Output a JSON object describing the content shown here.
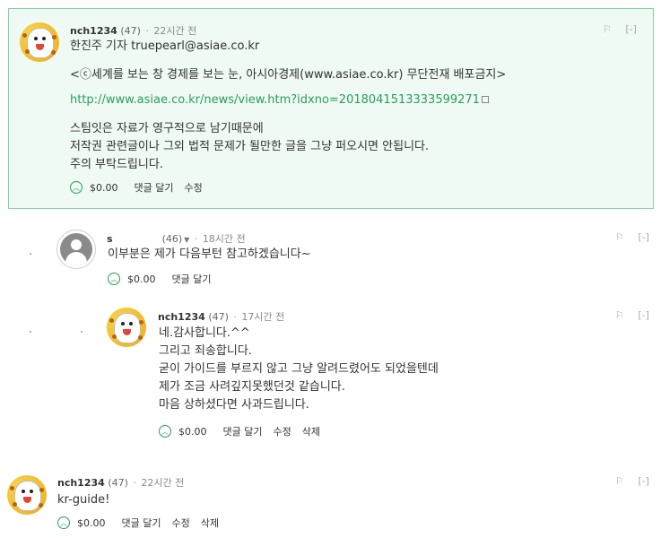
{
  "comments": [
    {
      "author": "nch1234",
      "reputation": "(47)",
      "separator": "·",
      "time": "22시간 전",
      "flag": "⚐",
      "collapse": "[-]",
      "lines": [
        "한진주 기자 truepearl@asiae.co.kr",
        "<ⓒ세계를 보는 창 경제를 보는 눈, 아시아경제(www.asiae.co.kr) 무단전재 배포금지>",
        "스팀잇은 자료가 영구적으로 남기때문에",
        "저작권 관련글이나 그외 법적 문제가 될만한 글을 그냥 퍼오시면 안됩니다.",
        "주의 부탁드립니다."
      ],
      "link": "http://www.asiae.co.kr/news/view.htm?idxno=2018041513333599271",
      "vote_icon": "upvote-icon",
      "payout": "$0.00",
      "actions": [
        "댓글 달기",
        "수정"
      ]
    },
    {
      "author": "s",
      "reputation": "(46)",
      "caret": "▼",
      "separator": "·",
      "time": "18시간 전",
      "flag": "⚐",
      "collapse": "[-]",
      "lines": [
        "이부분은 제가 다음부턴 참고하겠습니다~"
      ],
      "payout": "$0.00",
      "actions": [
        "댓글 달기"
      ]
    },
    {
      "author": "nch1234",
      "reputation": "(47)",
      "separator": "·",
      "time": "17시간 전",
      "flag": "⚐",
      "collapse": "[-]",
      "lines": [
        "네.감사합니다.^^",
        "그리고 죄송합니다.",
        "굳이 가이드를 부르지 않고 그냥 알려드렸어도 되었을텐데",
        "제가 조금 사려깊지못했던것 같습니다.",
        "마음 상하셨다면 사과드립니다."
      ],
      "payout": "$0.00",
      "actions": [
        "댓글 달기",
        "수정",
        "삭제"
      ]
    },
    {
      "author": "nch1234",
      "reputation": "(47)",
      "separator": "·",
      "time": "22시간 전",
      "flag": "⚐",
      "collapse": "[-]",
      "lines": [
        "kr-guide!"
      ],
      "payout": "$0.00",
      "actions": [
        "댓글 달기",
        "수정",
        "삭제"
      ]
    }
  ],
  "colors": {
    "accent": "#2a9d5c",
    "highlight_bg": "#eefaf3",
    "highlight_border": "#7fd3a6"
  }
}
